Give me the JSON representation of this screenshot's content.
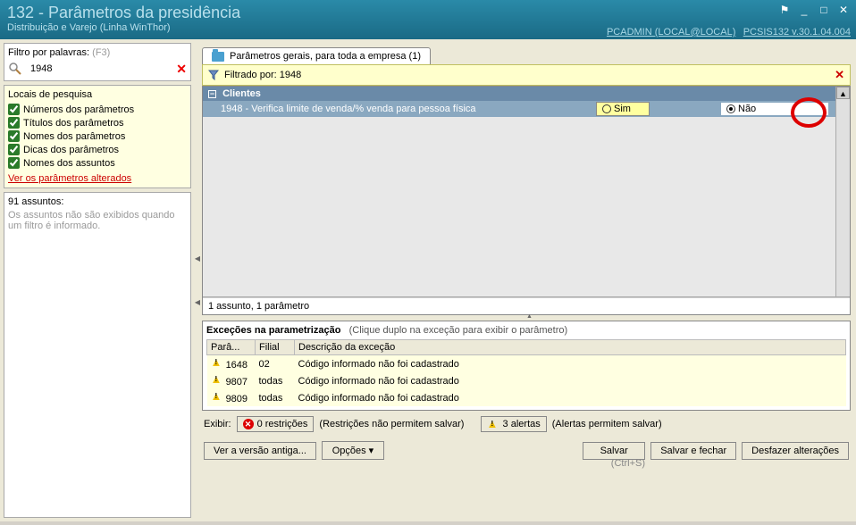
{
  "window": {
    "title": "132 - Parâmetros da presidência",
    "subtitle": "Distribuição e Varejo (Linha WinThor)",
    "user": "PCADMIN (LOCAL@LOCAL)",
    "version": "PCSIS132 v.30.1.04.004"
  },
  "filter": {
    "label": "Filtro por palavras:",
    "hint": "(F3)",
    "value": "1948"
  },
  "search_locations": {
    "title": "Locais de pesquisa",
    "items": [
      {
        "label": "Números dos parâmetros",
        "checked": true
      },
      {
        "label": "Títulos dos parâmetros",
        "checked": true
      },
      {
        "label": "Nomes dos parâmetros",
        "checked": true
      },
      {
        "label": "Dicas dos parâmetros",
        "checked": true
      },
      {
        "label": "Nomes dos assuntos",
        "checked": true
      }
    ],
    "link": "Ver os parâmetros alterados"
  },
  "subjects": {
    "title": "91 assuntos:",
    "empty_msg": "Os assuntos não são exibidos quando um filtro é informado."
  },
  "tab": {
    "label": "Parâmetros gerais, para toda a empresa  (1)"
  },
  "filtered_bar": {
    "label": "Filtrado por: 1948"
  },
  "grid": {
    "group": "Clientes",
    "row": {
      "desc": "1948 - Verifica limite de venda/% venda para pessoa física",
      "opt_yes": "Sim",
      "opt_no": "Não",
      "selected": "Não"
    },
    "footer": "1 assunto, 1 parâmetro"
  },
  "exceptions": {
    "title": "Exceções na parametrização",
    "hint": "(Clique duplo na exceção para exibir o parâmetro)",
    "cols": {
      "param": "Parâ...",
      "filial": "Filial",
      "desc": "Descrição da exceção"
    },
    "rows": [
      {
        "param": "1648",
        "filial": "02",
        "desc": "Código informado não foi cadastrado"
      },
      {
        "param": "9807",
        "filial": "todas",
        "desc": "Código informado não foi cadastrado"
      },
      {
        "param": "9809",
        "filial": "todas",
        "desc": "Código informado não foi cadastrado"
      }
    ]
  },
  "show": {
    "label": "Exibir:",
    "restrictions": "0 restrições",
    "restrictions_hint": "(Restrições não permitem salvar)",
    "alerts": "3 alertas",
    "alerts_hint": "(Alertas permitem salvar)"
  },
  "buttons": {
    "old_version": "Ver a versão antiga...",
    "options": "Opções",
    "save": "Salvar",
    "save_close": "Salvar e fechar",
    "undo": "Desfazer alterações",
    "save_hint": "(Ctrl+S)"
  }
}
